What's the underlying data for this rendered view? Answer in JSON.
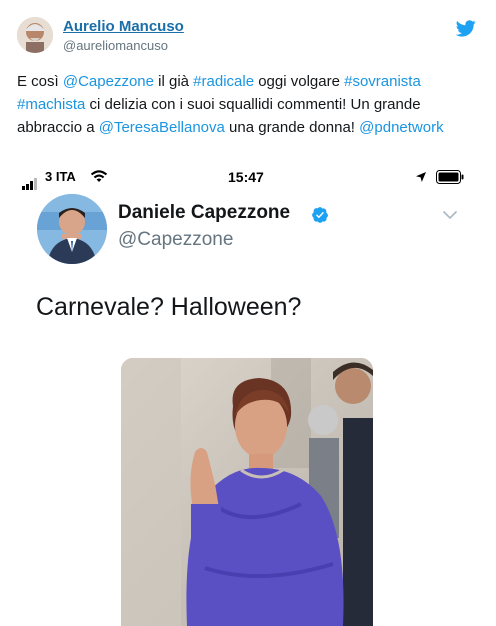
{
  "outer_tweet": {
    "author_name": "Aurelio Mancuso",
    "author_handle": "@aureliomancuso",
    "text_parts": [
      {
        "text": "E così ",
        "link": false
      },
      {
        "text": "@Capezzone",
        "link": true
      },
      {
        "text": " il già ",
        "link": false
      },
      {
        "text": "#radicale",
        "link": true
      },
      {
        "text": " oggi volgare ",
        "link": false
      },
      {
        "text": "#sovranista",
        "link": true
      },
      {
        "text": " ",
        "link": false
      },
      {
        "text": "#machista",
        "link": true
      },
      {
        "text": " ci delizia con i suoi squallidi commenti! Un grande abbraccio a ",
        "link": false
      },
      {
        "text": "@TeresaBellanova",
        "link": true
      },
      {
        "text": " una grande donna! ",
        "link": false
      },
      {
        "text": "@pdnetwork",
        "link": true
      }
    ],
    "icons": [
      "twitter-bird-icon"
    ]
  },
  "phone_status": {
    "carrier": "3 ITA",
    "time": "15:47",
    "icons": [
      "signal-icon",
      "wifi-icon",
      "location-arrow-icon",
      "battery-icon"
    ]
  },
  "embedded_tweet": {
    "author_name": "Daniele Capezzone",
    "author_handle": "@Capezzone",
    "text": "Carnevale? Halloween?",
    "icons": [
      "verified-badge-icon",
      "chevron-down-icon"
    ]
  },
  "colors": {
    "link": "#1b95e0",
    "name_link": "#1b6fa8",
    "muted": "#66757f",
    "verified": "#1da1f2"
  }
}
